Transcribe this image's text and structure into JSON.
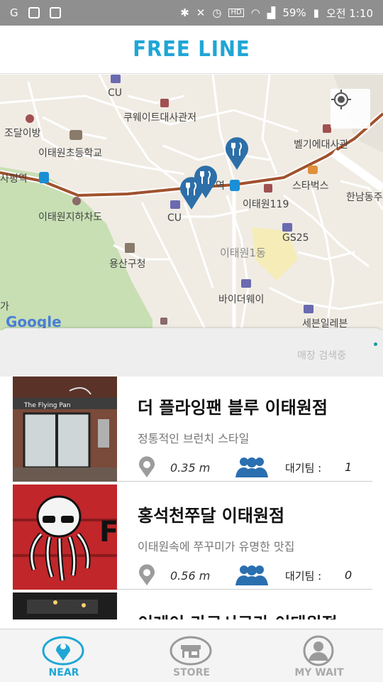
{
  "status_bar": {
    "battery": "59%",
    "time": "오전 1:10",
    "hd": "HD"
  },
  "header": {
    "title": "FREE LINE"
  },
  "map": {
    "labels": [
      {
        "text": "CU"
      },
      {
        "text": "쿠웨이트대사관저"
      },
      {
        "text": "조달이방"
      },
      {
        "text": "이태원초등학교"
      },
      {
        "text": "벨기에대사관"
      },
      {
        "text": "사평역"
      },
      {
        "text": "역"
      },
      {
        "text": "스타벅스"
      },
      {
        "text": "한남동주"
      },
      {
        "text": "이태원119"
      },
      {
        "text": "이태원지하차도"
      },
      {
        "text": "CU"
      },
      {
        "text": "GS25"
      },
      {
        "text": "용산구청"
      },
      {
        "text": "이태원1동"
      },
      {
        "text": "바이더웨이"
      },
      {
        "text": "세븐일레븐"
      },
      {
        "text": "가"
      }
    ],
    "google": "Google"
  },
  "search": {
    "status": "매장 검색중"
  },
  "stores": [
    {
      "name": "더 플라잉팬 블루 이태원점",
      "description": "정통적인 브런치 스타일",
      "distance": "0.35 m",
      "wait_label": "대기팀 :",
      "wait_count": "1",
      "photo_text": "The Flying Pan"
    },
    {
      "name": "홍석천쭈달 이태원점",
      "description": "이태원속에 쭈꾸미가 유명한 맛집",
      "distance": "0.56 m",
      "wait_label": "대기팀 :",
      "wait_count": "0"
    },
    {
      "name": "이레이 라쿠시쿠라 이태원점"
    }
  ],
  "nav": {
    "near": "NEAR",
    "store": "STORE",
    "my_wait": "MY WAIT"
  },
  "colors": {
    "accent": "#1fa6d6",
    "map_pin": "#2d6fa8",
    "road_main": "#a0522d"
  }
}
